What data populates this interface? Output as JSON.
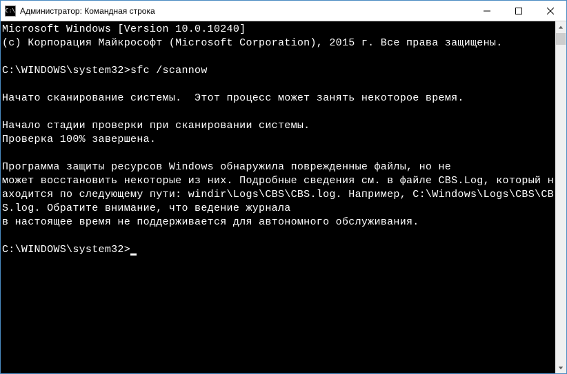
{
  "window": {
    "title": "Администратор: Командная строка",
    "icon_label": "C:\\"
  },
  "console": {
    "lines": [
      "Microsoft Windows [Version 10.0.10240]",
      "(c) Корпорация Майкрософт (Microsoft Corporation), 2015 г. Все права защищены.",
      "",
      "C:\\WINDOWS\\system32>sfc /scannow",
      "",
      "Начато сканирование системы.  Этот процесс может занять некоторое время.",
      "",
      "Начало стадии проверки при сканировании системы.",
      "Проверка 100% завершена.",
      "",
      "Программа защиты ресурсов Windows обнаружила поврежденные файлы, но не",
      "может восстановить некоторые из них. Подробные сведения см. в файле CBS.Log, который находится по следующему пути: windir\\Logs\\CBS\\CBS.log. Например, C:\\Windows\\Logs\\CBS\\CBS.log. Обратите внимание, что ведение журнала",
      "в настоящее время не поддерживается для автономного обслуживания.",
      "",
      "C:\\WINDOWS\\system32>"
    ],
    "prompt_cursor_line_index": 14
  }
}
